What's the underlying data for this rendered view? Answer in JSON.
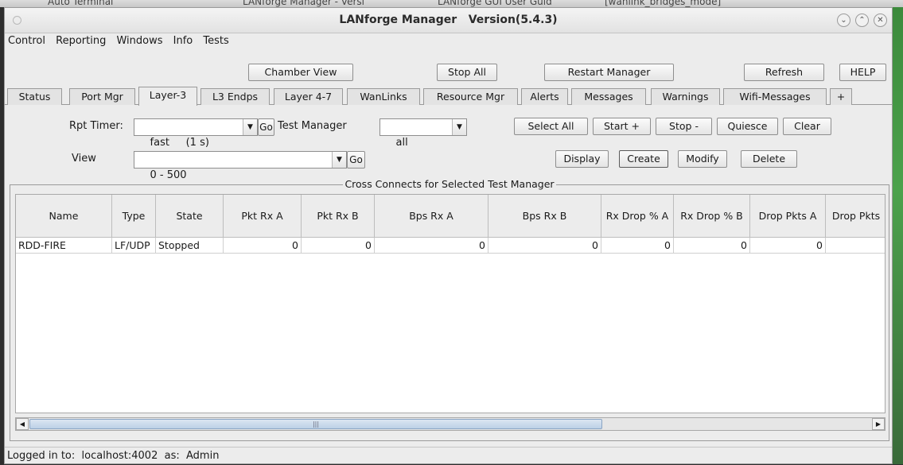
{
  "taskbar": {
    "items": [
      "Auto Terminal",
      "LANforge Manager - Versi",
      "LANforge GUI User Guid",
      "[wanlink_bridges_mode]"
    ]
  },
  "window": {
    "title": "LANforge Manager   Version(5.4.3)"
  },
  "menu": {
    "items": [
      {
        "label": "Control"
      },
      {
        "label": "Reporting"
      },
      {
        "label": "Windows"
      },
      {
        "label": "Info"
      },
      {
        "label": "Tests"
      }
    ]
  },
  "toolbar": {
    "chamber_view": "Chamber View",
    "stop_all": "Stop All",
    "restart_manager": "Restart Manager",
    "refresh": "Refresh",
    "help": "HELP"
  },
  "tabs": [
    {
      "label": "Status"
    },
    {
      "label": "Port Mgr"
    },
    {
      "label": "Layer-3"
    },
    {
      "label": "L3 Endps"
    },
    {
      "label": "Layer 4-7"
    },
    {
      "label": "WanLinks"
    },
    {
      "label": "Resource Mgr"
    },
    {
      "label": "Alerts"
    },
    {
      "label": "Messages"
    },
    {
      "label": "Warnings"
    },
    {
      "label": "Wifi-Messages"
    },
    {
      "label": "+"
    }
  ],
  "active_tab": "Layer-3",
  "controls": {
    "rpt_timer_label": "Rpt Timer:",
    "rpt_timer_value": "fast     (1 s)",
    "go_label": "Go",
    "test_manager_label": "Test Manager",
    "test_manager_value": "all",
    "view_label": "View",
    "view_value": "0 - 500",
    "select_all": "Select All",
    "start": "Start +",
    "stop": "Stop -",
    "quiesce": "Quiesce",
    "clear": "Clear",
    "display": "Display",
    "create": "Create",
    "modify": "Modify",
    "delete": "Delete"
  },
  "group": {
    "title": "Cross Connects for Selected Test Manager"
  },
  "table": {
    "columns": [
      "Name",
      "Type",
      "State",
      "Pkt Rx A",
      "Pkt Rx B",
      "Bps Rx A",
      "Bps Rx B",
      "Rx Drop % A",
      "Rx Drop % B",
      "Drop Pkts A",
      "Drop Pkts"
    ],
    "rows": [
      [
        "RDD-FIRE",
        "LF/UDP",
        "Stopped",
        "0",
        "0",
        "0",
        "0",
        "0",
        "0",
        "0",
        ""
      ]
    ]
  },
  "status": {
    "text": "Logged in to:  localhost:4002  as:  Admin"
  },
  "colors": {
    "window_bg": "#ececec",
    "scroll_thumb": "#bcd0e6"
  }
}
